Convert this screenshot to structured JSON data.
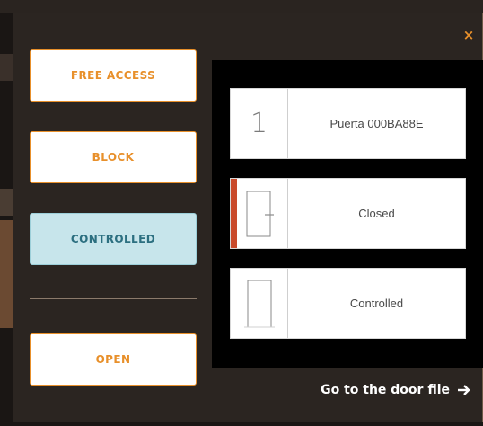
{
  "modal": {
    "close_glyph": "×",
    "side_buttons": [
      {
        "label": "FREE ACCESS"
      },
      {
        "label": "BLOCK"
      },
      {
        "label": "CONTROLLED"
      },
      {
        "label": "OPEN"
      }
    ],
    "door_cards": [
      {
        "icon_text": "1",
        "label": "Puerta 000BA88E"
      },
      {
        "label": "Closed"
      },
      {
        "label": "Controlled"
      }
    ],
    "goto_label": "Go to the door file",
    "colors": {
      "accent": "#e8902b",
      "active_bg": "#c7e5eb",
      "active_text": "#2c6f80",
      "alert_red": "#c94a2b"
    },
    "icons": {
      "close": "close-icon",
      "door_closed": "door-closed-icon",
      "door_controlled": "door-controlled-icon",
      "arrow": "arrow-right-icon"
    }
  }
}
